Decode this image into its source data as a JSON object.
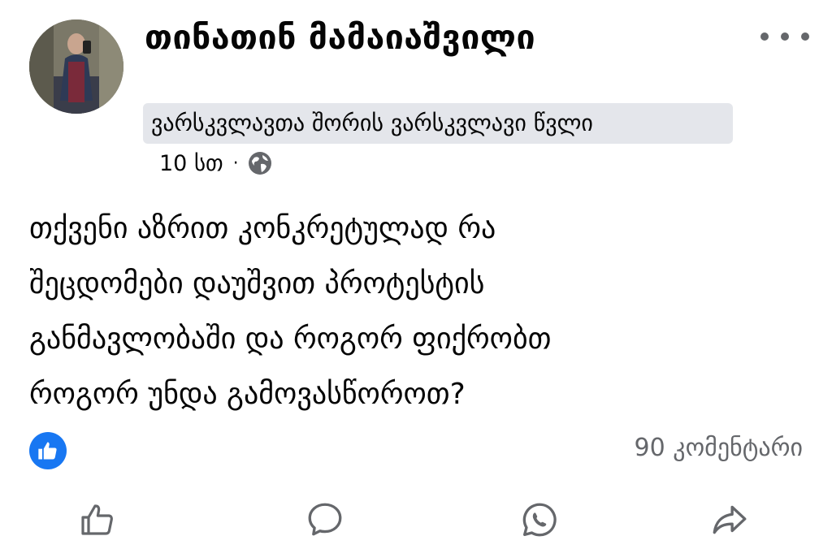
{
  "post": {
    "author": "თინათინ მამაიაშვილი",
    "group": "ვარსკვლავთა შორის ვარსკვლავი წვლი",
    "time": "10 სთ",
    "separator": "·",
    "privacy_icon": "globe-icon",
    "body": "თქვენი აზრით კონკრეტულად რა\nშეცდომები დაუშვით პროტესტის\nგანმავლობაში და როგორ ფიქრობთ\nროგორ უნდა გამოვასწოროთ?",
    "comments_label": "90 კომენტარი"
  },
  "icons": {
    "more": "more-dots-icon",
    "reaction": "like-reaction-icon",
    "like": "thumbs-up-icon",
    "comment": "comment-bubble-icon",
    "whatsapp": "whatsapp-icon",
    "share": "share-arrow-icon"
  },
  "colors": {
    "accent": "#1877f2",
    "secondary_text": "#65676b",
    "chip_bg": "#e4e6eb"
  }
}
